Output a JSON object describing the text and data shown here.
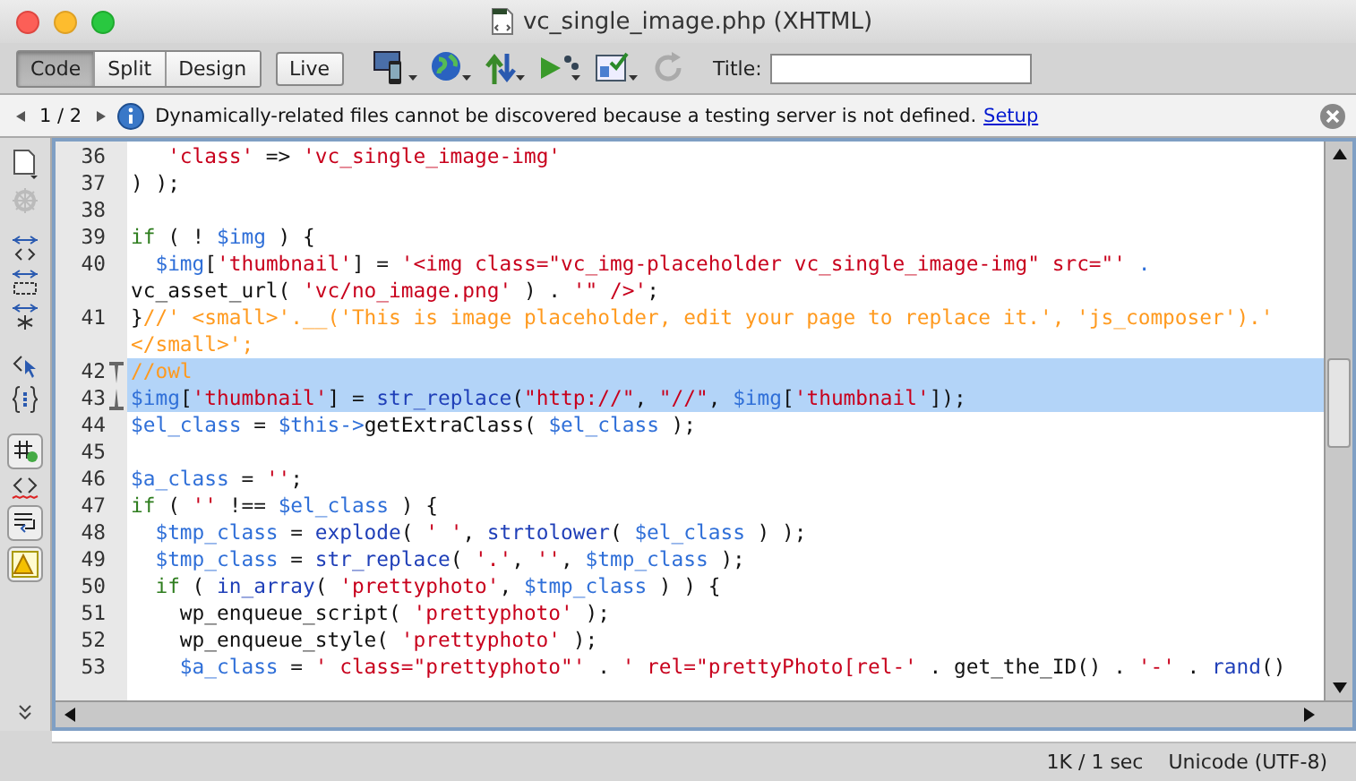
{
  "window": {
    "title": "vc_single_image.php (XHTML)"
  },
  "view_tabs": [
    {
      "label": "Code",
      "selected": true
    },
    {
      "label": "Split",
      "selected": false
    },
    {
      "label": "Design",
      "selected": false
    }
  ],
  "live_button": {
    "label": "Live"
  },
  "title_field": {
    "label": "Title:"
  },
  "info_bar": {
    "pager": "1 / 2",
    "message": "Dynamically-related files cannot be discovered because a testing server is not defined.",
    "link": "Setup"
  },
  "code": [
    {
      "number": "36",
      "selected": false,
      "fold_start": false,
      "fold_end": false,
      "rows": [
        {
          "tokens": [
            {
              "kind": "str",
              "text": "   'class'"
            },
            {
              "kind": "plain",
              "text": " => "
            },
            {
              "kind": "str",
              "text": "'vc_single_image-img'"
            }
          ]
        }
      ]
    },
    {
      "number": "37",
      "selected": false,
      "fold_start": false,
      "fold_end": false,
      "rows": [
        {
          "tokens": [
            {
              "kind": "plain",
              "text": ") );"
            }
          ]
        }
      ]
    },
    {
      "number": "38",
      "selected": false,
      "fold_start": false,
      "fold_end": false,
      "rows": [
        {
          "tokens": []
        }
      ]
    },
    {
      "number": "39",
      "selected": false,
      "fold_start": false,
      "fold_end": false,
      "rows": [
        {
          "tokens": [
            {
              "kind": "kw",
              "text": "if"
            },
            {
              "kind": "plain",
              "text": " ( ! "
            },
            {
              "kind": "var",
              "text": "$img"
            },
            {
              "kind": "plain",
              "text": " ) {"
            }
          ]
        }
      ]
    },
    {
      "number": "40",
      "selected": false,
      "fold_start": false,
      "fold_end": false,
      "rows": [
        {
          "tokens": [
            {
              "kind": "var",
              "text": "  $img"
            },
            {
              "kind": "plain",
              "text": "["
            },
            {
              "kind": "str",
              "text": "'thumbnail'"
            },
            {
              "kind": "plain",
              "text": "] = "
            },
            {
              "kind": "str",
              "text": "'<img class=\"vc_img-placeholder vc_single_image-img\" src=\"'"
            },
            {
              "kind": "var",
              "text": " ."
            }
          ]
        },
        {
          "tokens": [
            {
              "kind": "plain",
              "text": "vc_asset_url( "
            },
            {
              "kind": "str",
              "text": "'vc/no_image.png'"
            },
            {
              "kind": "plain",
              "text": " ) . "
            },
            {
              "kind": "str",
              "text": "'\" />'"
            },
            {
              "kind": "plain",
              "text": ";"
            }
          ]
        }
      ]
    },
    {
      "number": "41",
      "selected": false,
      "fold_start": false,
      "fold_end": false,
      "rows": [
        {
          "tokens": [
            {
              "kind": "plain",
              "text": "}"
            },
            {
              "kind": "cmt",
              "text": "//' <small>'.__('This is image placeholder, edit your page to replace it.', 'js_composer').'"
            }
          ]
        },
        {
          "tokens": [
            {
              "kind": "cmt",
              "text": "</small>';"
            }
          ]
        }
      ]
    },
    {
      "number": "42",
      "selected": true,
      "fold_start": true,
      "fold_end": false,
      "rows": [
        {
          "tokens": [
            {
              "kind": "cmt",
              "text": "//owl"
            }
          ]
        }
      ]
    },
    {
      "number": "43",
      "selected": true,
      "fold_start": false,
      "fold_end": true,
      "rows": [
        {
          "tokens": [
            {
              "kind": "var",
              "text": "$img"
            },
            {
              "kind": "plain",
              "text": "["
            },
            {
              "kind": "str",
              "text": "'thumbnail'"
            },
            {
              "kind": "plain",
              "text": "] = "
            },
            {
              "kind": "fn",
              "text": "str_replace"
            },
            {
              "kind": "plain",
              "text": "("
            },
            {
              "kind": "str",
              "text": "\"http://\""
            },
            {
              "kind": "plain",
              "text": ", "
            },
            {
              "kind": "str",
              "text": "\"//\""
            },
            {
              "kind": "plain",
              "text": ", "
            },
            {
              "kind": "var",
              "text": "$img"
            },
            {
              "kind": "plain",
              "text": "["
            },
            {
              "kind": "str",
              "text": "'thumbnail'"
            },
            {
              "kind": "plain",
              "text": "]);"
            }
          ]
        }
      ]
    },
    {
      "number": "44",
      "selected": false,
      "fold_start": false,
      "fold_end": false,
      "rows": [
        {
          "tokens": [
            {
              "kind": "var",
              "text": "$el_class"
            },
            {
              "kind": "plain",
              "text": " = "
            },
            {
              "kind": "var",
              "text": "$this->"
            },
            {
              "kind": "plain",
              "text": "getExtraClass( "
            },
            {
              "kind": "var",
              "text": "$el_class"
            },
            {
              "kind": "plain",
              "text": " );"
            }
          ]
        }
      ]
    },
    {
      "number": "45",
      "selected": false,
      "fold_start": false,
      "fold_end": false,
      "rows": [
        {
          "tokens": []
        }
      ]
    },
    {
      "number": "46",
      "selected": false,
      "fold_start": false,
      "fold_end": false,
      "rows": [
        {
          "tokens": [
            {
              "kind": "var",
              "text": "$a_class"
            },
            {
              "kind": "plain",
              "text": " = "
            },
            {
              "kind": "str",
              "text": "''"
            },
            {
              "kind": "plain",
              "text": ";"
            }
          ]
        }
      ]
    },
    {
      "number": "47",
      "selected": false,
      "fold_start": false,
      "fold_end": false,
      "rows": [
        {
          "tokens": [
            {
              "kind": "kw",
              "text": "if"
            },
            {
              "kind": "plain",
              "text": " ( "
            },
            {
              "kind": "str",
              "text": "''"
            },
            {
              "kind": "plain",
              "text": " !== "
            },
            {
              "kind": "var",
              "text": "$el_class"
            },
            {
              "kind": "plain",
              "text": " ) {"
            }
          ]
        }
      ]
    },
    {
      "number": "48",
      "selected": false,
      "fold_start": false,
      "fold_end": false,
      "rows": [
        {
          "tokens": [
            {
              "kind": "var",
              "text": "  $tmp_class"
            },
            {
              "kind": "plain",
              "text": " = "
            },
            {
              "kind": "fn",
              "text": "explode"
            },
            {
              "kind": "plain",
              "text": "( "
            },
            {
              "kind": "str",
              "text": "' '"
            },
            {
              "kind": "plain",
              "text": ", "
            },
            {
              "kind": "fn",
              "text": "strtolower"
            },
            {
              "kind": "plain",
              "text": "( "
            },
            {
              "kind": "var",
              "text": "$el_class"
            },
            {
              "kind": "plain",
              "text": " ) );"
            }
          ]
        }
      ]
    },
    {
      "number": "49",
      "selected": false,
      "fold_start": false,
      "fold_end": false,
      "rows": [
        {
          "tokens": [
            {
              "kind": "var",
              "text": "  $tmp_class"
            },
            {
              "kind": "plain",
              "text": " = "
            },
            {
              "kind": "fn",
              "text": "str_replace"
            },
            {
              "kind": "plain",
              "text": "( "
            },
            {
              "kind": "str",
              "text": "'.'"
            },
            {
              "kind": "plain",
              "text": ", "
            },
            {
              "kind": "str",
              "text": "''"
            },
            {
              "kind": "plain",
              "text": ", "
            },
            {
              "kind": "var",
              "text": "$tmp_class"
            },
            {
              "kind": "plain",
              "text": " );"
            }
          ]
        }
      ]
    },
    {
      "number": "50",
      "selected": false,
      "fold_start": false,
      "fold_end": false,
      "rows": [
        {
          "tokens": [
            {
              "kind": "kw",
              "text": "  if"
            },
            {
              "kind": "plain",
              "text": " ( "
            },
            {
              "kind": "fn",
              "text": "in_array"
            },
            {
              "kind": "plain",
              "text": "( "
            },
            {
              "kind": "str",
              "text": "'prettyphoto'"
            },
            {
              "kind": "plain",
              "text": ", "
            },
            {
              "kind": "var",
              "text": "$tmp_class"
            },
            {
              "kind": "plain",
              "text": " ) ) {"
            }
          ]
        }
      ]
    },
    {
      "number": "51",
      "selected": false,
      "fold_start": false,
      "fold_end": false,
      "rows": [
        {
          "tokens": [
            {
              "kind": "plain",
              "text": "    wp_enqueue_script( "
            },
            {
              "kind": "str",
              "text": "'prettyphoto'"
            },
            {
              "kind": "plain",
              "text": " );"
            }
          ]
        }
      ]
    },
    {
      "number": "52",
      "selected": false,
      "fold_start": false,
      "fold_end": false,
      "rows": [
        {
          "tokens": [
            {
              "kind": "plain",
              "text": "    wp_enqueue_style( "
            },
            {
              "kind": "str",
              "text": "'prettyphoto'"
            },
            {
              "kind": "plain",
              "text": " );"
            }
          ]
        }
      ]
    },
    {
      "number": "53",
      "selected": false,
      "fold_start": false,
      "fold_end": false,
      "rows": [
        {
          "tokens": [
            {
              "kind": "var",
              "text": "    $a_class"
            },
            {
              "kind": "plain",
              "text": " = "
            },
            {
              "kind": "str",
              "text": "' class=\"prettyphoto\"'"
            },
            {
              "kind": "plain",
              "text": " . "
            },
            {
              "kind": "str",
              "text": "' rel=\"prettyPhoto[rel-'"
            },
            {
              "kind": "plain",
              "text": " . get_the_ID() . "
            },
            {
              "kind": "str",
              "text": "'-'"
            },
            {
              "kind": "plain",
              "text": " . "
            },
            {
              "kind": "fn",
              "text": "rand"
            },
            {
              "kind": "plain",
              "text": "()"
            }
          ]
        }
      ]
    }
  ],
  "status_bar": {
    "size": "1K / 1 sec",
    "encoding": "Unicode (UTF-8)"
  }
}
